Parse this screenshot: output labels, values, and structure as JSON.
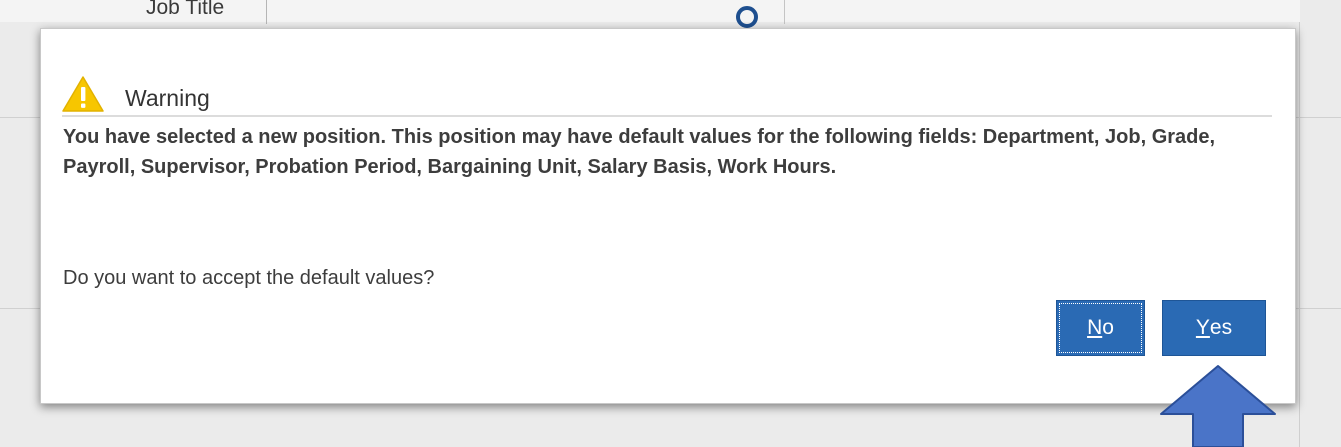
{
  "background": {
    "field_label": "Job Title"
  },
  "dialog": {
    "title": "Warning",
    "icon": "warning-triangle-icon",
    "message": "You have selected a new position. This position may have default values for the following fields: Department, Job, Grade, Payroll, Supervisor, Probation Period, Bargaining Unit, Salary Basis, Work Hours.",
    "question": "Do you want to accept the default values?",
    "buttons": {
      "no": {
        "mnemonic": "N",
        "rest": "o"
      },
      "yes": {
        "mnemonic": "Y",
        "rest": "es"
      }
    }
  },
  "colors": {
    "button_bg": "#2a6ab4",
    "warning_yellow": "#f7c600",
    "pointer_arrow": "#4a74c8"
  }
}
